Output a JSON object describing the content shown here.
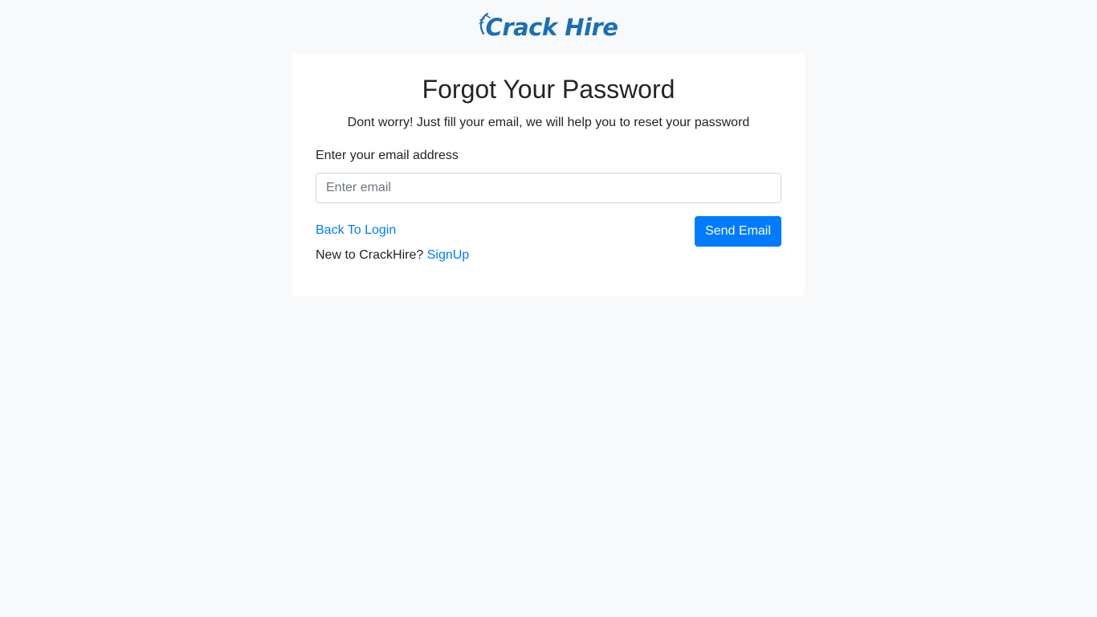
{
  "brand": {
    "name": "Crack Hire",
    "color": "#1a6fb5"
  },
  "page": {
    "title": "Forgot Your Password",
    "subtitle": "Dont worry! Just fill your email, we will help you to reset your password"
  },
  "form": {
    "email_label": "Enter your email address",
    "email_value": "",
    "email_placeholder": "Enter email",
    "send_label": "Send Email",
    "back_label": "Back To Login",
    "signup_prompt": "New to CrackHire?",
    "signup_label": "SignUp"
  },
  "colors": {
    "background": "#f8f9fa",
    "card": "#ffffff",
    "primary": "#007bff",
    "text": "#212529"
  },
  "icons": {
    "logo_mark": "swoosh-arc-icon"
  }
}
